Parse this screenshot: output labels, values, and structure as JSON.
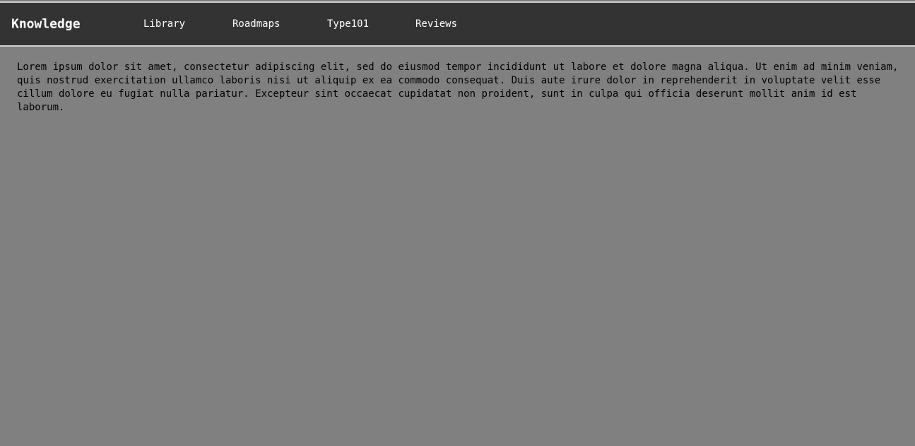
{
  "navbar": {
    "brand": "Knowledge",
    "links": [
      {
        "label": "Library"
      },
      {
        "label": "Roadmaps"
      },
      {
        "label": "Type101"
      },
      {
        "label": "Reviews"
      }
    ]
  },
  "main": {
    "body_text": "Lorem ipsum dolor sit amet, consectetur adipiscing elit, sed do eiusmod tempor incididunt ut labore et dolore magna aliqua. Ut enim ad minim veniam, quis nostrud exercitation ullamco laboris nisi ut aliquip ex ea commodo consequat. Duis aute irure dolor in reprehenderit in voluptate velit esse cillum dolore eu fugiat nulla pariatur. Excepteur sint occaecat cupidatat non proident, sunt in culpa qui officia deserunt mollit anim id est laborum."
  },
  "colors": {
    "navbar_bg": "#333333",
    "page_bg": "#808080",
    "nav_text": "#ffffff",
    "body_text": "#000000"
  }
}
